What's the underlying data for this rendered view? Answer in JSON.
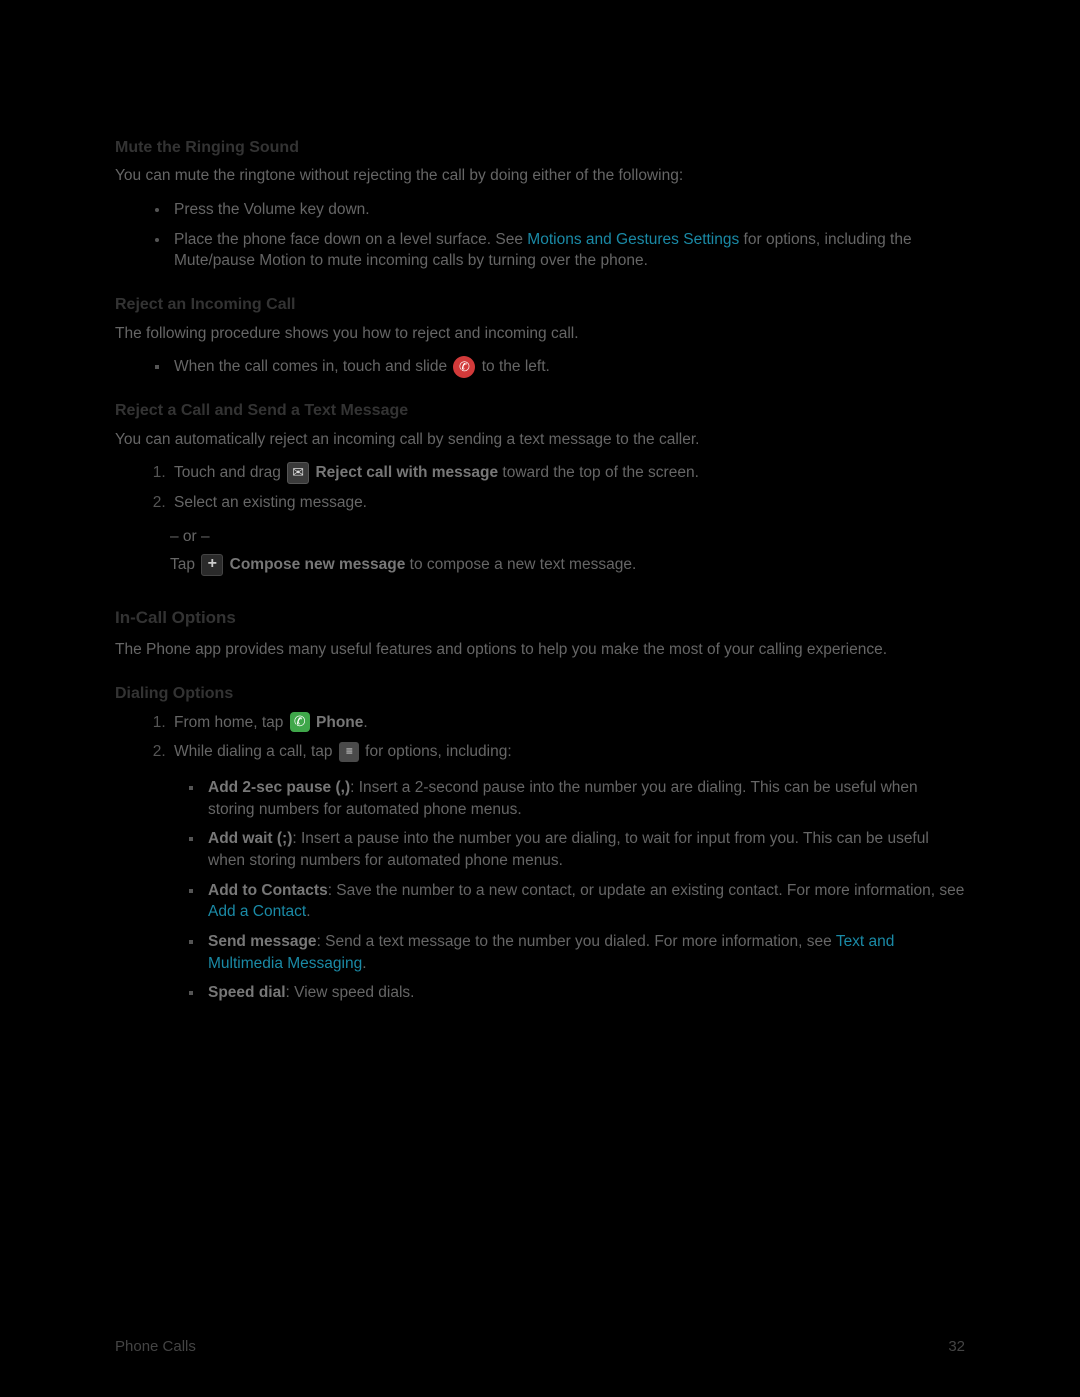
{
  "section1": {
    "heading": "Mute the Ringing Sound",
    "intro": "You can mute the ringtone without rejecting the call by doing either of the following:",
    "bullets": [
      "Press the Volume key down.",
      "Place the phone face down on a level surface. See "
    ],
    "bullet2_link": "Motions and Gestures Settings",
    "bullet2_after": " for options, including the Mute/pause Motion to mute incoming calls by turning over the phone."
  },
  "section2": {
    "heading": "Reject an Incoming Call",
    "intro": "The following procedure shows you how to reject and incoming call.",
    "item_pre": "When the call comes in, touch and slide ",
    "item_post": " to the left."
  },
  "section3": {
    "heading": "Reject a Call and Send a Text Message",
    "intro": "You can automatically reject an incoming call by sending a text message to the caller.",
    "step1_pre": "Touch and drag ",
    "step1_bold": " Reject call with message",
    "step1_post": " toward the top of the screen.",
    "step2": "Select an existing message.",
    "or": "– or –",
    "compose_pre": "Tap ",
    "compose_bold": " Compose new message",
    "compose_post": " to compose a new text message."
  },
  "section4": {
    "heading": "In-Call Options",
    "intro": "The Phone app provides many useful features and options to help you make the most of your calling experience."
  },
  "section5": {
    "heading": "Dialing Options",
    "step1_pre": "From home, tap ",
    "step1_bold": " Phone",
    "step1_post": ".",
    "step2_pre": "While dialing a call, tap ",
    "step2_post": " for options, including:",
    "opts": {
      "a_bold": "Add 2-sec pause (,)",
      "a_rest": ": Insert a 2-second pause into the number you are dialing. This can be useful when storing numbers for automated phone menus.",
      "b_bold": "Add wait (;)",
      "b_rest": ": Insert a pause into the number you are dialing, to wait for input from you. This can be useful when storing numbers for automated phone menus.",
      "c_bold": "Add to Contacts",
      "c_rest": ": Save the number to a new contact, or update an existing contact. For more information, see ",
      "c_link": "Add a Contact",
      "c_end": ".",
      "d_bold": "Send message",
      "d_rest": ": Send a text message to the number you dialed. For more information, see ",
      "d_link": "Text and Multimedia Messaging",
      "d_end": ".",
      "e_bold": "Speed dial",
      "e_rest": ": View speed dials."
    }
  },
  "footer": {
    "left": "Phone Calls",
    "right": "32"
  }
}
